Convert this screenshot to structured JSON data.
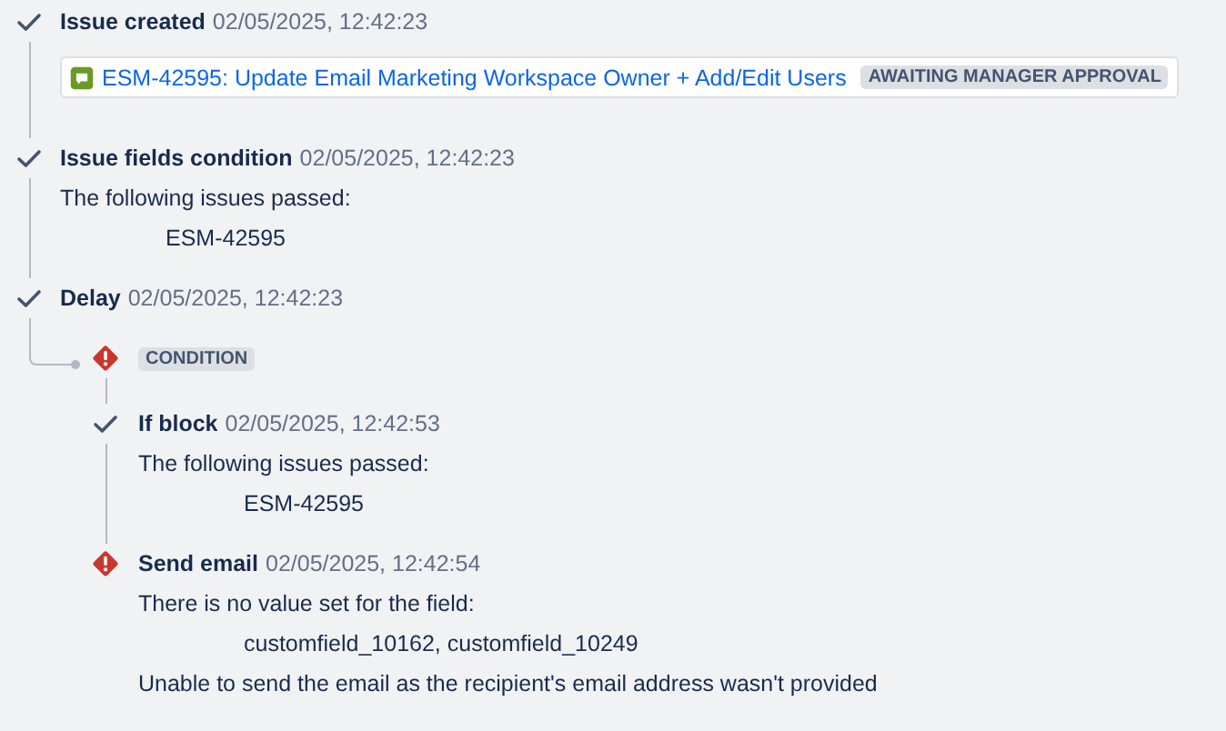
{
  "entries": [
    {
      "kind": "check",
      "title": "Issue created",
      "time": "02/05/2025, 12:42:23",
      "issue_card": {
        "link": "ESM-42595: Update Email Marketing Workspace Owner + Add/Edit Users",
        "status": "AWAITING MANAGER APPROVAL"
      }
    },
    {
      "kind": "check",
      "title": "Issue fields condition",
      "time": "02/05/2025, 12:42:23",
      "lines": [
        {
          "kind": "text",
          "text": "The following issues passed:"
        },
        {
          "kind": "indented",
          "text": "ESM-42595"
        }
      ]
    },
    {
      "kind": "check",
      "title": "Delay",
      "time": "02/05/2025, 12:42:23"
    },
    {
      "kind": "branch",
      "children": [
        {
          "kind": "error",
          "lozenge": "CONDITION"
        },
        {
          "kind": "check",
          "title": "If block",
          "time": "02/05/2025, 12:42:53",
          "lines": [
            {
              "kind": "text",
              "text": "The following issues passed:"
            },
            {
              "kind": "indented",
              "text": "ESM-42595"
            }
          ]
        },
        {
          "kind": "error",
          "title": "Send email",
          "time": "02/05/2025, 12:42:54",
          "lines": [
            {
              "kind": "text",
              "text": "There is no value set for the field:"
            },
            {
              "kind": "indented",
              "text": "customfield_10162, customfield_10249"
            },
            {
              "kind": "text",
              "text": "Unable to send the email as the recipient's email address wasn't provided"
            }
          ]
        }
      ]
    }
  ]
}
